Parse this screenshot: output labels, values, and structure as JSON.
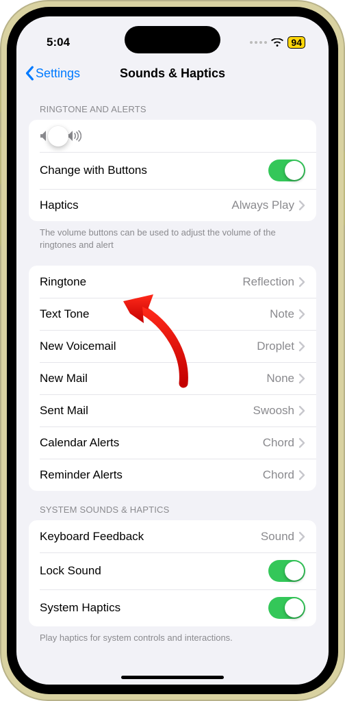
{
  "status": {
    "time": "5:04",
    "battery": "94"
  },
  "nav": {
    "back": "Settings",
    "title": "Sounds & Haptics"
  },
  "slider": {
    "percent": 58
  },
  "sections": {
    "alerts": {
      "header": "RINGTONE AND ALERTS",
      "change_with_buttons": "Change with Buttons",
      "haptics_label": "Haptics",
      "haptics_value": "Always Play",
      "footer": "The volume buttons can be used to adjust the volume of the ringtones and alert"
    },
    "sounds": {
      "items": [
        {
          "label": "Ringtone",
          "value": "Reflection"
        },
        {
          "label": "Text Tone",
          "value": "Note"
        },
        {
          "label": "New Voicemail",
          "value": "Droplet"
        },
        {
          "label": "New Mail",
          "value": "None"
        },
        {
          "label": "Sent Mail",
          "value": "Swoosh"
        },
        {
          "label": "Calendar Alerts",
          "value": "Chord"
        },
        {
          "label": "Reminder Alerts",
          "value": "Chord"
        }
      ]
    },
    "system": {
      "header": "SYSTEM SOUNDS & HAPTICS",
      "keyboard_label": "Keyboard Feedback",
      "keyboard_value": "Sound",
      "lock_label": "Lock Sound",
      "system_haptics_label": "System Haptics",
      "footer": "Play haptics for system controls and interactions."
    }
  },
  "toggles": {
    "change_with_buttons": true,
    "lock_sound": true,
    "system_haptics": true
  }
}
